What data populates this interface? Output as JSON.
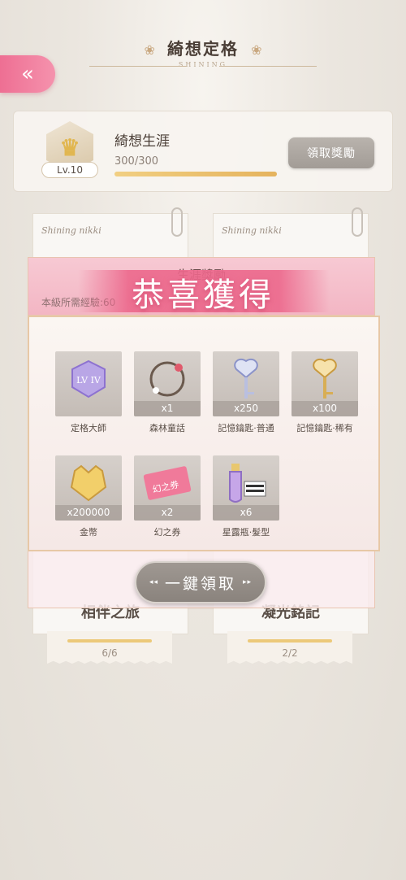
{
  "header": {
    "title": "綺想定格",
    "subtitle": "SHINING",
    "back_glyph": "«"
  },
  "career": {
    "name": "綺想生涯",
    "level": "Lv.10",
    "progress_text": "300/300",
    "progress": 1.0,
    "claim_label": "領取獎勵"
  },
  "cards": [
    {
      "brand": "Shining nikki",
      "title": "相伴之旅",
      "progress_text": "6/6"
    },
    {
      "brand": "Shining nikki",
      "title": "凝光銘記",
      "progress_text": "2/2"
    }
  ],
  "modal": {
    "title": "生涯獎勵",
    "exp_text": "本級所需經驗:60",
    "congrats": "恭喜獲得",
    "items": [
      {
        "name": "定格大師",
        "qty": "",
        "icon": "level-badge-icon"
      },
      {
        "name": "森林童話",
        "qty": "x1",
        "icon": "flower-wreath-icon"
      },
      {
        "name": "記憶鑰匙·普通",
        "qty": "x250",
        "icon": "silver-key-icon"
      },
      {
        "name": "記憶鑰匙·稀有",
        "qty": "x100",
        "icon": "gold-key-icon"
      },
      {
        "name": "金幣",
        "qty": "x200000",
        "icon": "gold-coin-icon"
      },
      {
        "name": "幻之券",
        "qty": "x2",
        "icon": "ticket-icon"
      },
      {
        "name": "星露瓶·髮型",
        "qty": "x6",
        "icon": "potion-bottle-icon"
      }
    ],
    "one_click_label": "一鍵領取",
    "ticket_text": "幻之券",
    "badge_text": "LV IV"
  },
  "colors": {
    "accent_pink": "#ee6f93",
    "gold": "#e5b35d"
  }
}
